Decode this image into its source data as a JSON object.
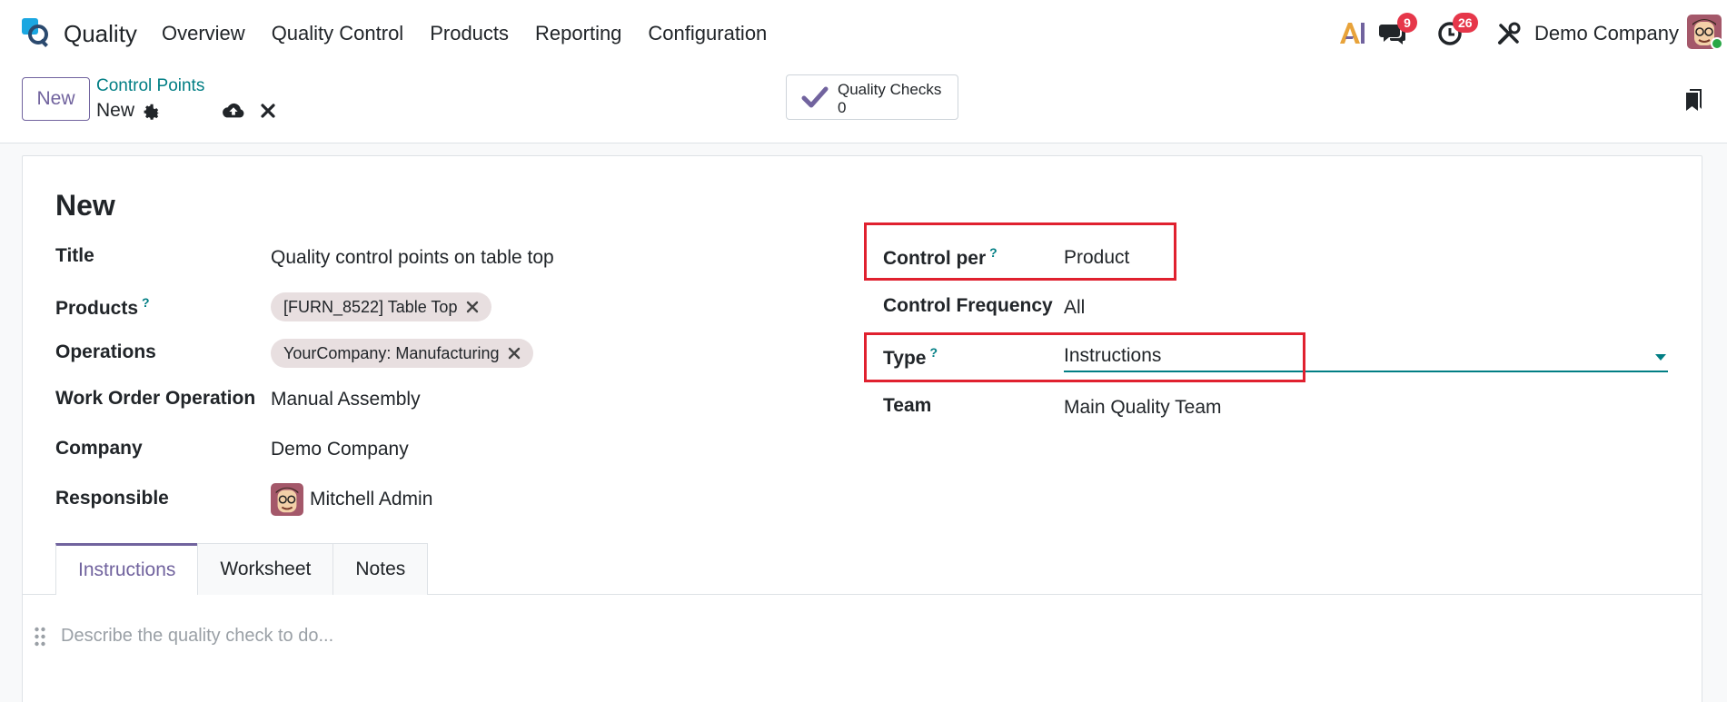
{
  "app": {
    "name": "Quality"
  },
  "menu": [
    {
      "label": "Overview"
    },
    {
      "label": "Quality Control"
    },
    {
      "label": "Products"
    },
    {
      "label": "Reporting"
    },
    {
      "label": "Configuration"
    }
  ],
  "systray": {
    "ai_icon": "ai-icon",
    "messages_badge": "9",
    "activities_badge": "26",
    "company": "Demo Company"
  },
  "control_panel": {
    "new_label": "New",
    "breadcrumb": "Control Points",
    "record_name": "New",
    "smart_button": {
      "label": "Quality Checks",
      "value": "0"
    }
  },
  "form": {
    "title": "New",
    "left_fields": [
      {
        "label": "Title",
        "value": "Quality control points on table top"
      },
      {
        "label": "Products",
        "help": "?",
        "tags": [
          "[FURN_8522] Table Top"
        ]
      },
      {
        "label": "Operations",
        "tags": [
          "YourCompany: Manufacturing"
        ]
      },
      {
        "label": "Work Order Operation",
        "value": "Manual Assembly"
      },
      {
        "label": "Company",
        "value": "Demo Company"
      },
      {
        "label": "Responsible",
        "value": "Mitchell Admin"
      }
    ],
    "right_fields": [
      {
        "label": "Control per",
        "help": "?",
        "value": "Product"
      },
      {
        "label": "Control Frequency",
        "value": "All"
      },
      {
        "label": "Type",
        "help": "?",
        "value": "Instructions"
      },
      {
        "label": "Team",
        "value": "Main Quality Team"
      }
    ]
  },
  "tabs": [
    {
      "label": "Instructions",
      "active": true
    },
    {
      "label": "Worksheet",
      "active": false
    },
    {
      "label": "Notes",
      "active": false
    }
  ],
  "editor": {
    "placeholder": "Describe the quality check to do..."
  },
  "colors": {
    "accent": "#71639e",
    "link": "#017e84",
    "badge": "#e6374a",
    "highlight": "#e0212f"
  }
}
